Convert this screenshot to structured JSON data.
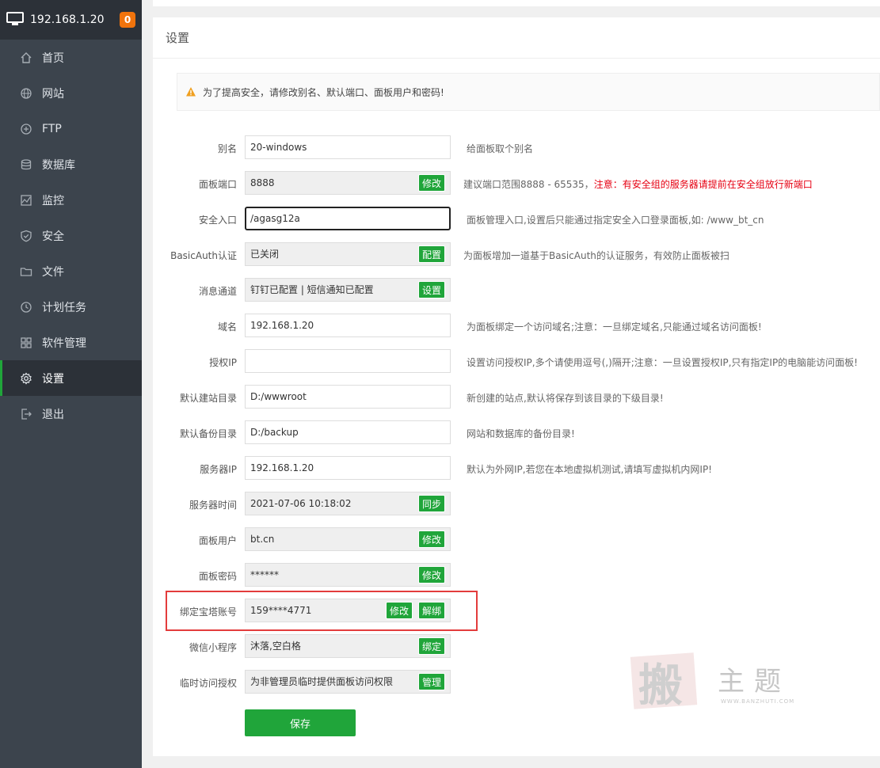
{
  "sidebar": {
    "host": "192.168.1.20",
    "badge": "0",
    "items": [
      {
        "label": "首页",
        "icon": "home-icon"
      },
      {
        "label": "网站",
        "icon": "globe-icon"
      },
      {
        "label": "FTP",
        "icon": "ftp-icon"
      },
      {
        "label": "数据库",
        "icon": "database-icon"
      },
      {
        "label": "监控",
        "icon": "monitor-icon"
      },
      {
        "label": "安全",
        "icon": "shield-icon"
      },
      {
        "label": "文件",
        "icon": "folder-icon"
      },
      {
        "label": "计划任务",
        "icon": "clock-icon"
      },
      {
        "label": "软件管理",
        "icon": "grid-icon"
      },
      {
        "label": "设置",
        "icon": "gear-icon"
      },
      {
        "label": "退出",
        "icon": "logout-icon"
      }
    ],
    "active": "设置"
  },
  "panel": {
    "title": "设置",
    "alert": "为了提高安全，请修改别名、默认端口、面板用户和密码!"
  },
  "settings": {
    "alias": {
      "label": "别名",
      "value": "20-windows",
      "hint": "给面板取个别名"
    },
    "port": {
      "label": "面板端口",
      "value": "8888",
      "btn": "修改",
      "hint_prefix": "建议端口范围8888 - 65535，",
      "hint_red": "注意：有安全组的服务器请提前在安全组放行新端口"
    },
    "entry": {
      "label": "安全入口",
      "value": "/agasg12a",
      "hint": "面板管理入口,设置后只能通过指定安全入口登录面板,如: /www_bt_cn"
    },
    "basicauth": {
      "label": "BasicAuth认证",
      "value": "已关闭",
      "btn": "配置",
      "hint": "为面板增加一道基于BasicAuth的认证服务，有效防止面板被扫"
    },
    "msg": {
      "label": "消息通道",
      "value": "钉钉已配置 | 短信通知已配置",
      "btn": "设置"
    },
    "domain": {
      "label": "域名",
      "value": "192.168.1.20",
      "hint": "为面板绑定一个访问域名;注意：一旦绑定域名,只能通过域名访问面板!"
    },
    "authip": {
      "label": "授权IP",
      "value": "",
      "hint": "设置访问授权IP,多个请使用逗号(,)隔开;注意：一旦设置授权IP,只有指定IP的电脑能访问面板!"
    },
    "sitedir": {
      "label": "默认建站目录",
      "value": "D:/wwwroot",
      "hint": "新创建的站点,默认将保存到该目录的下级目录!"
    },
    "backupdir": {
      "label": "默认备份目录",
      "value": "D:/backup",
      "hint": "网站和数据库的备份目录!"
    },
    "serverip": {
      "label": "服务器IP",
      "value": "192.168.1.20",
      "hint": "默认为外网IP,若您在本地虚拟机测试,请填写虚拟机内网IP!"
    },
    "servertime": {
      "label": "服务器时间",
      "value": "2021-07-06 10:18:02",
      "btn": "同步"
    },
    "user": {
      "label": "面板用户",
      "value": "bt.cn",
      "btn": "修改"
    },
    "password": {
      "label": "面板密码",
      "value": "******",
      "btn": "修改"
    },
    "account": {
      "label": "绑定宝塔账号",
      "value": "159****4771",
      "btn1": "修改",
      "btn2": "解绑"
    },
    "wechat": {
      "label": "微信小程序",
      "value": "沐落,空白格",
      "btn": "绑定"
    },
    "temp": {
      "label": "临时访问授权",
      "value": "为非管理员临时提供面板访问权限",
      "btn": "管理"
    },
    "save": "保存"
  },
  "watermark": {
    "big": "搬",
    "text": "主题",
    "sub": "WWW.BANZHUTI.COM"
  },
  "colors": {
    "accent": "#20a53a",
    "sidebar": "#3c444d",
    "badge": "#f0730c",
    "warn_red": "#e60012",
    "highlight": "#e33c3c"
  }
}
